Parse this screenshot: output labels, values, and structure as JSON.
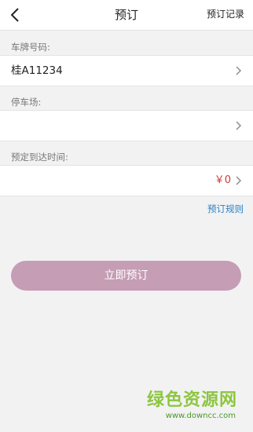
{
  "header": {
    "title": "预订",
    "records_label": "预订记录"
  },
  "form": {
    "plate": {
      "label": "车牌号码:",
      "value": "桂A11234"
    },
    "parking_lot": {
      "label": "停车场:",
      "value": ""
    },
    "arrival_time": {
      "label": "预定到达时间:",
      "value": "",
      "price": "￥0"
    }
  },
  "rules_link": "预订规则",
  "book_button": "立即预订",
  "watermark": {
    "text": "绿色资源网",
    "url": "www.downcc.com"
  },
  "colors": {
    "accent_button": "#c59db4",
    "price": "#d23a3a",
    "link": "#2a7fc1",
    "watermark": "#8cc63f"
  }
}
